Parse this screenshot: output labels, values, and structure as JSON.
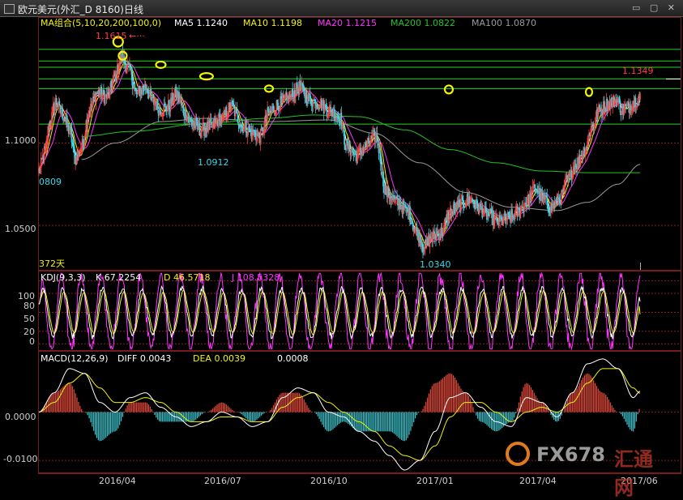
{
  "window": {
    "title": "欧元美元(外汇_D 8160)日线",
    "controls": "▭ ▢ ✕"
  },
  "colors": {
    "background": "#000000",
    "up": "#ff4040",
    "down": "#3ad7e6",
    "ma5": "#ffffff",
    "ma10": "#f2f20a",
    "ma20": "#ff33ff",
    "ma200": "#27c227",
    "ma100": "#9a9a9a",
    "hline": "#27d327",
    "grid": "#8a1e1e",
    "highlight": "#f5f500",
    "kline": "#ffffff",
    "dline": "#f2f20a",
    "jline": "#ff33ff",
    "hist_up": "#e84c3d",
    "hist_down": "#3ec6cf"
  },
  "main_panel": {
    "ma_header": "MA组合(5,10,20,200,100,0)",
    "ma_legend": [
      {
        "name": "MA5",
        "value": "1.1240",
        "color": "#ffffff"
      },
      {
        "name": "MA10",
        "value": "1.1198",
        "color": "#f2f20a"
      },
      {
        "name": "MA20",
        "value": "1.1215",
        "color": "#ff33ff"
      },
      {
        "name": "MA200",
        "value": "1.0822",
        "color": "#27c227"
      },
      {
        "name": "MA100",
        "value": "1.0870",
        "color": "#9a9a9a"
      }
    ],
    "y_ticks": [
      "1.1000",
      "1.0500"
    ],
    "annotations": {
      "high_label": "1.1615",
      "last_label": "1.1349",
      "low_label": "1.0340",
      "mid_label": "1.0912",
      "left_label": "0809",
      "days_label": "372天"
    }
  },
  "kdj_panel": {
    "header": "KDJ(9,3,3)",
    "legend": [
      {
        "name": "K",
        "value": "67.2254",
        "color": "#ffffff"
      },
      {
        "name": "D",
        "value": "46.5718",
        "color": "#f2f20a"
      },
      {
        "name": "J",
        "value": "108.5328",
        "color": "#ff33ff"
      }
    ],
    "y_ticks": [
      "100",
      "80",
      "50",
      "20",
      "0"
    ]
  },
  "macd_panel": {
    "header": "MACD(12,26,9)",
    "legend": [
      {
        "name": "DIFF",
        "value": "0.0043",
        "color": "#ffffff"
      },
      {
        "name": "DEA",
        "value": "0.0039",
        "color": "#f2f20a"
      },
      {
        "name": "",
        "value": "0.0008",
        "color": "#ffffff"
      }
    ],
    "y_ticks": [
      "0.0000",
      "-0.0100"
    ]
  },
  "x_axis": {
    "labels": [
      "2016/04",
      "2016/07",
      "2016/10",
      "2017/01",
      "2017/04",
      "2017/06"
    ]
  },
  "watermark": {
    "brand": "FX678",
    "brand_cn": "汇通网"
  },
  "chart_data": [
    {
      "type": "candlestick",
      "title": "欧元美元(外汇_D 8160)日线",
      "ylim": [
        1.023,
        1.176
      ],
      "horizontal_levels": [
        1.1569,
        1.1498,
        1.146,
        1.139,
        1.133,
        1.1115
      ],
      "price_path": [
        [
          0,
          1.083
        ],
        [
          8,
          1.095
        ],
        [
          14,
          1.112
        ],
        [
          22,
          1.125
        ],
        [
          30,
          1.118
        ],
        [
          40,
          1.108
        ],
        [
          48,
          1.09
        ],
        [
          56,
          1.098
        ],
        [
          66,
          1.12
        ],
        [
          76,
          1.13
        ],
        [
          90,
          1.128
        ],
        [
          100,
          1.14
        ],
        [
          108,
          1.152
        ],
        [
          118,
          1.145
        ],
        [
          128,
          1.13
        ],
        [
          140,
          1.134
        ],
        [
          150,
          1.125
        ],
        [
          160,
          1.12
        ],
        [
          170,
          1.122
        ],
        [
          180,
          1.13
        ],
        [
          192,
          1.118
        ],
        [
          200,
          1.112
        ],
        [
          214,
          1.108
        ],
        [
          225,
          1.11
        ],
        [
          240,
          1.115
        ],
        [
          252,
          1.122
        ],
        [
          268,
          1.11
        ],
        [
          280,
          1.106
        ],
        [
          290,
          1.104
        ],
        [
          302,
          1.118
        ],
        [
          316,
          1.124
        ],
        [
          330,
          1.128
        ],
        [
          342,
          1.134
        ],
        [
          356,
          1.126
        ],
        [
          368,
          1.124
        ],
        [
          380,
          1.12
        ],
        [
          394,
          1.116
        ],
        [
          404,
          1.098
        ],
        [
          418,
          1.092
        ],
        [
          428,
          1.098
        ],
        [
          442,
          1.104
        ],
        [
          456,
          1.07
        ],
        [
          470,
          1.064
        ],
        [
          484,
          1.058
        ],
        [
          496,
          1.046
        ],
        [
          506,
          1.037
        ],
        [
          516,
          1.043
        ],
        [
          528,
          1.046
        ],
        [
          540,
          1.058
        ],
        [
          552,
          1.062
        ],
        [
          566,
          1.066
        ],
        [
          578,
          1.06
        ],
        [
          590,
          1.056
        ],
        [
          602,
          1.052
        ],
        [
          616,
          1.054
        ],
        [
          628,
          1.058
        ],
        [
          640,
          1.064
        ],
        [
          652,
          1.072
        ],
        [
          662,
          1.066
        ],
        [
          672,
          1.061
        ],
        [
          684,
          1.066
        ],
        [
          694,
          1.078
        ],
        [
          706,
          1.088
        ],
        [
          716,
          1.096
        ],
        [
          726,
          1.11
        ],
        [
          736,
          1.12
        ],
        [
          748,
          1.124
        ],
        [
          758,
          1.126
        ],
        [
          766,
          1.12
        ],
        [
          774,
          1.122
        ],
        [
          782,
          1.126
        ],
        [
          789,
          1.128
        ]
      ],
      "ma200_path": [
        [
          56,
          1.104
        ],
        [
          120,
          1.107
        ],
        [
          220,
          1.112
        ],
        [
          300,
          1.115
        ],
        [
          360,
          1.117
        ],
        [
          420,
          1.116
        ],
        [
          480,
          1.108
        ],
        [
          540,
          1.096
        ],
        [
          600,
          1.088
        ],
        [
          660,
          1.083
        ],
        [
          720,
          1.082
        ],
        [
          789,
          1.082
        ]
      ],
      "ma100_path": [
        [
          56,
          1.09
        ],
        [
          100,
          1.1
        ],
        [
          160,
          1.113
        ],
        [
          220,
          1.115
        ],
        [
          300,
          1.113
        ],
        [
          380,
          1.114
        ],
        [
          440,
          1.106
        ],
        [
          500,
          1.088
        ],
        [
          560,
          1.07
        ],
        [
          620,
          1.061
        ],
        [
          680,
          1.059
        ],
        [
          720,
          1.064
        ],
        [
          760,
          1.075
        ],
        [
          789,
          1.087
        ]
      ],
      "last_value": 1.1349,
      "marked_high": 1.1615,
      "marked_low": 1.034,
      "marked_mid_low": 1.0912
    },
    {
      "type": "line",
      "title": "KDJ(9,3,3)",
      "ylim": [
        -10,
        115
      ],
      "y_ticks": [
        100,
        80,
        50,
        20,
        0
      ],
      "series": [
        {
          "name": "K",
          "final": 67.2254
        },
        {
          "name": "D",
          "final": 46.5718
        },
        {
          "name": "J",
          "final": 108.5328
        }
      ]
    },
    {
      "type": "bar",
      "title": "MACD(12,26,9)",
      "ylim": [
        -0.0125,
        0.0125
      ],
      "y_ticks": [
        0.0,
        -0.01
      ],
      "diff_path": [
        [
          0,
          0.0
        ],
        [
          20,
          0.004
        ],
        [
          40,
          0.009
        ],
        [
          60,
          0.008
        ],
        [
          80,
          0.002
        ],
        [
          100,
          0.0
        ],
        [
          120,
          0.003
        ],
        [
          140,
          0.004
        ],
        [
          160,
          0.001
        ],
        [
          180,
          -0.001
        ],
        [
          200,
          -0.003
        ],
        [
          220,
          -0.002
        ],
        [
          240,
          0.0
        ],
        [
          260,
          -0.001
        ],
        [
          280,
          -0.003
        ],
        [
          300,
          -0.002
        ],
        [
          320,
          0.003
        ],
        [
          340,
          0.005
        ],
        [
          360,
          0.004
        ],
        [
          380,
          0.0
        ],
        [
          400,
          -0.001
        ],
        [
          420,
          -0.004
        ],
        [
          440,
          -0.006
        ],
        [
          460,
          -0.009
        ],
        [
          480,
          -0.012
        ],
        [
          500,
          -0.01
        ],
        [
          520,
          -0.004
        ],
        [
          540,
          0.003
        ],
        [
          560,
          0.004
        ],
        [
          580,
          0.001
        ],
        [
          600,
          -0.002
        ],
        [
          620,
          -0.003
        ],
        [
          640,
          0.003
        ],
        [
          660,
          0.002
        ],
        [
          680,
          -0.001
        ],
        [
          700,
          0.004
        ],
        [
          720,
          0.01
        ],
        [
          740,
          0.011
        ],
        [
          760,
          0.009
        ],
        [
          780,
          0.003
        ],
        [
          789,
          0.0043
        ]
      ],
      "dea_path": [
        [
          0,
          0.0
        ],
        [
          20,
          0.002
        ],
        [
          40,
          0.006
        ],
        [
          60,
          0.008
        ],
        [
          80,
          0.005
        ],
        [
          100,
          0.002
        ],
        [
          120,
          0.002
        ],
        [
          140,
          0.003
        ],
        [
          160,
          0.002
        ],
        [
          180,
          0.0
        ],
        [
          200,
          -0.002
        ],
        [
          220,
          -0.002
        ],
        [
          240,
          -0.001
        ],
        [
          260,
          -0.001
        ],
        [
          280,
          -0.002
        ],
        [
          300,
          -0.002
        ],
        [
          320,
          0.001
        ],
        [
          340,
          0.003
        ],
        [
          360,
          0.004
        ],
        [
          380,
          0.002
        ],
        [
          400,
          0.0
        ],
        [
          420,
          -0.002
        ],
        [
          440,
          -0.004
        ],
        [
          460,
          -0.007
        ],
        [
          480,
          -0.009
        ],
        [
          500,
          -0.01
        ],
        [
          520,
          -0.007
        ],
        [
          540,
          -0.001
        ],
        [
          560,
          0.002
        ],
        [
          580,
          0.002
        ],
        [
          600,
          0.0
        ],
        [
          620,
          -0.002
        ],
        [
          640,
          0.0
        ],
        [
          660,
          0.001
        ],
        [
          680,
          0.0
        ],
        [
          700,
          0.002
        ],
        [
          720,
          0.006
        ],
        [
          740,
          0.009
        ],
        [
          760,
          0.009
        ],
        [
          780,
          0.005
        ],
        [
          789,
          0.0039
        ]
      ],
      "last_hist": 0.0008
    }
  ]
}
